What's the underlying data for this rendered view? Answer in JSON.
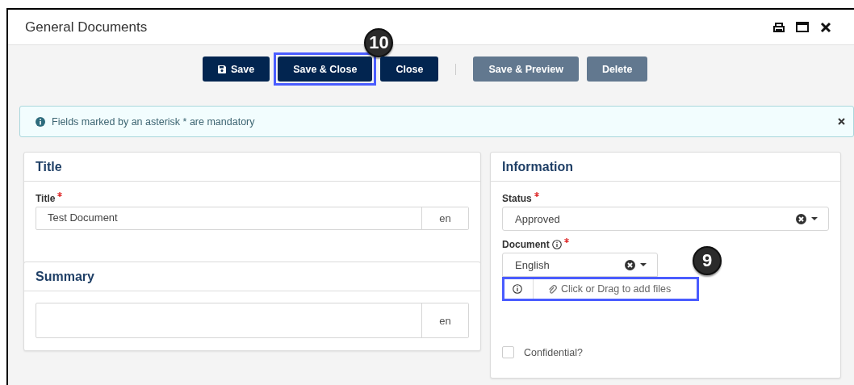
{
  "window": {
    "title": "General Documents"
  },
  "toolbar": {
    "buttons": [
      {
        "label": "Save",
        "kind": "save",
        "disabled": false,
        "highlighted": false
      },
      {
        "label": "Save & Close",
        "kind": "plain",
        "disabled": false,
        "highlighted": true,
        "callout": "10"
      },
      {
        "label": "Close",
        "kind": "plain",
        "disabled": false,
        "highlighted": false
      },
      {
        "label": "Save & Preview",
        "kind": "plain",
        "disabled": true,
        "highlighted": false
      },
      {
        "label": "Delete",
        "kind": "plain",
        "disabled": true,
        "highlighted": false
      }
    ]
  },
  "notice": {
    "text": "Fields marked by an asterisk * are mandatory"
  },
  "title_card": {
    "heading": "Title",
    "field": {
      "label": "Title",
      "required": true,
      "value": "Test Document",
      "language": "en"
    }
  },
  "summary_card": {
    "heading": "Summary",
    "field": {
      "language": "en"
    }
  },
  "information_card": {
    "heading": "Information",
    "status": {
      "label": "Status",
      "required": true,
      "value": "Approved"
    },
    "document": {
      "label": "Document",
      "required": true,
      "value": "English",
      "upload": {
        "text": "Click or Drag to add files",
        "highlighted": true,
        "callout": "9"
      }
    },
    "confidential": {
      "label": "Confidential?",
      "checked": false
    }
  }
}
